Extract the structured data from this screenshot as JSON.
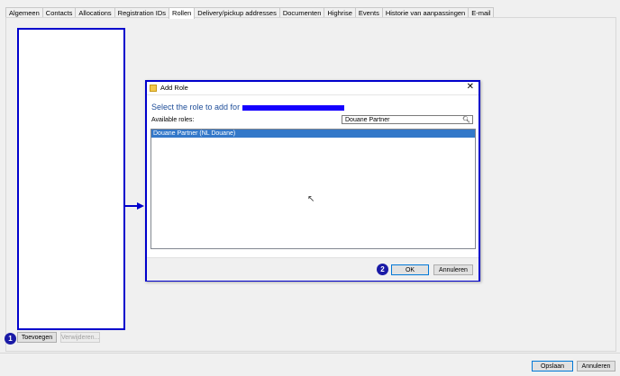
{
  "tabs": [
    "Algemeen",
    "Contacts",
    "Allocations",
    "Registration IDs",
    "Rollen",
    "Delivery/pickup addresses",
    "Documenten",
    "Highrise",
    "Events",
    "Historie van aanpassingen",
    "E-mail"
  ],
  "active_tab": "Rollen",
  "panel": {
    "add_button": "Toevoegen",
    "remove_button": "Verwijderen..."
  },
  "dialog": {
    "title": "Add Role",
    "close_glyph": "✕",
    "heading": "Select the role to add for",
    "available_label": "Available roles:",
    "search_value": "Douane Partner",
    "roles": [
      "Douane Partner (NL Douane)"
    ],
    "ok_button": "OK",
    "cancel_button": "Annuleren"
  },
  "footer": {
    "save_button": "Opslaan",
    "cancel_button": "Annuleren"
  },
  "badges": [
    "1",
    "2"
  ],
  "colors": {
    "annotation": "#0000cc",
    "selection": "#3378c9",
    "heading": "#1f4e99"
  }
}
